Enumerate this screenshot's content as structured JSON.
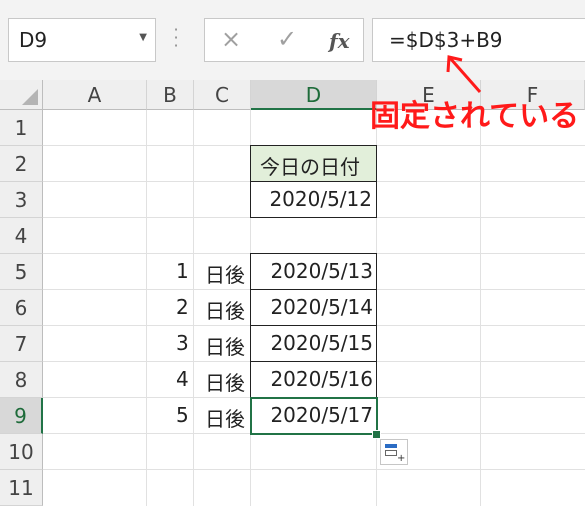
{
  "namebox": {
    "value": "D9"
  },
  "formula_bar": {
    "cancel_icon": "×",
    "enter_icon": "✓",
    "fx_label": "fx",
    "formula": "=$D$3+B9"
  },
  "columns": [
    "A",
    "B",
    "C",
    "D",
    "E",
    "F"
  ],
  "rows": [
    "1",
    "2",
    "3",
    "4",
    "5",
    "6",
    "7",
    "8",
    "9",
    "10",
    "11"
  ],
  "selected_cell": {
    "column": "D",
    "row": "9"
  },
  "cells": {
    "D2": "今日の日付",
    "D3": "2020/5/12",
    "B5": "1",
    "C5": "日後",
    "D5": "2020/5/13",
    "B6": "2",
    "C6": "日後",
    "D6": "2020/5/14",
    "B7": "3",
    "C7": "日後",
    "D7": "2020/5/15",
    "B8": "4",
    "C8": "日後",
    "D8": "2020/5/16",
    "B9": "5",
    "C9": "日後",
    "D9": "2020/5/17"
  },
  "annotation": {
    "text": "固定されている",
    "color": "#ff1a1a"
  },
  "colors": {
    "accent": "#217346",
    "header_fill": "#e2efda"
  }
}
